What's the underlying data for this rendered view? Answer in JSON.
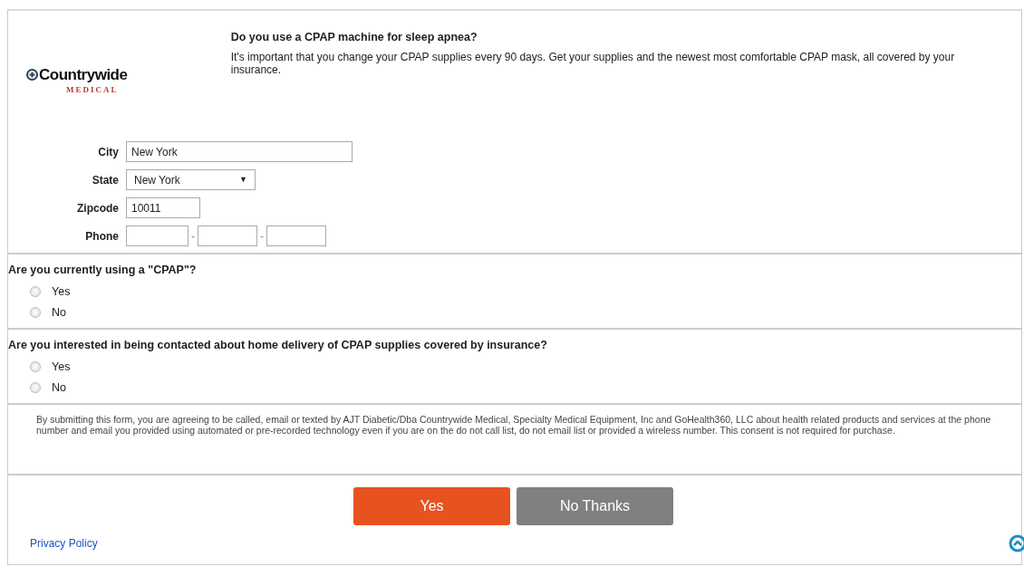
{
  "logo": {
    "name": "Countrywide",
    "subtitle": "MEDICAL"
  },
  "header": {
    "title": "Do you use a CPAP machine for sleep apnea?",
    "text": "It's important that you change your CPAP supplies every 90 days. Get your supplies and the newest most comfortable CPAP mask, all covered by your insurance."
  },
  "fields": [
    {
      "kind": "text",
      "label": "City",
      "value": "New York"
    },
    {
      "kind": "select",
      "label": "State",
      "value": "New York",
      "caret": "▼"
    },
    {
      "kind": "zip",
      "label": "Zipcode",
      "value": "10011"
    },
    {
      "kind": "phone",
      "label": "Phone",
      "separators": [
        "-",
        "-"
      ]
    }
  ],
  "questions": [
    {
      "text": "Are you currently using a \"CPAP\"?",
      "options": [
        {
          "label": "Yes",
          "selected": false
        },
        {
          "label": "No",
          "selected": false
        }
      ]
    },
    {
      "text": "Are you interested in being contacted about home delivery of CPAP supplies covered by insurance?",
      "options": [
        {
          "label": "Yes",
          "selected": false
        },
        {
          "label": "No",
          "selected": false
        }
      ]
    }
  ],
  "consent": "By submitting this form, you are agreeing to be called, email or texted by AJT Diabetic/Dba Countrywide Medical, Specialty Medical Equipment, Inc and GoHealth360, LLC about health related products and services at the phone number and email you provided using automated or pre-recorded technology even if you are on the do not call list, do not email list or provided a wireless number. This consent is not required for purchase.",
  "buttons": [
    {
      "kind": "primary",
      "label": "Yes"
    },
    {
      "kind": "secondary",
      "label": "No Thanks"
    }
  ],
  "privacy_link": "Privacy Policy"
}
